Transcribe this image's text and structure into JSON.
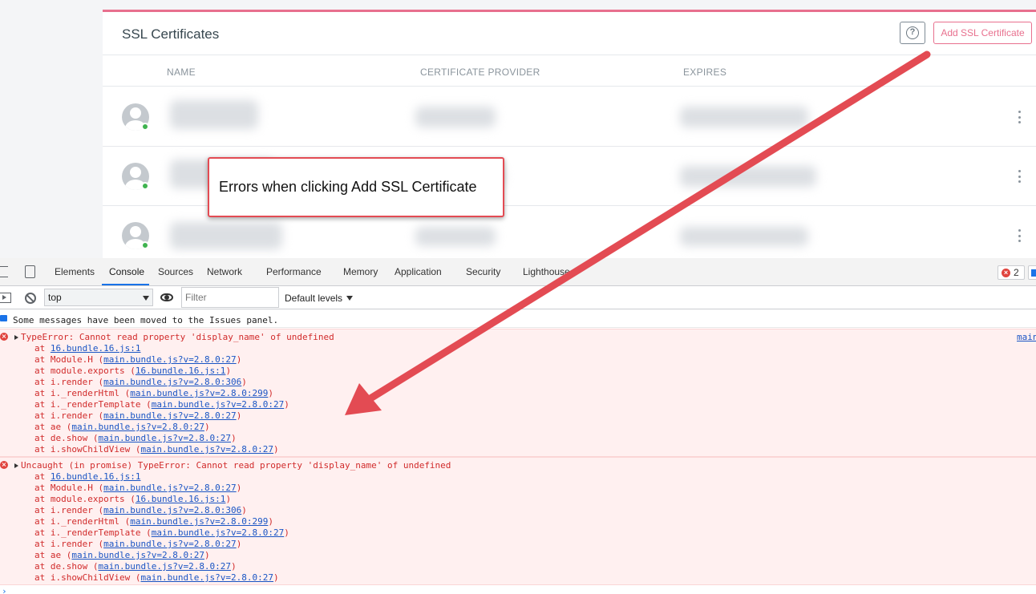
{
  "app": {
    "title": "SSL Certificates",
    "help_icon": "question-circle-icon",
    "help_glyph": "?",
    "add_button": "Add SSL Certificate",
    "columns": [
      "NAME",
      "CERTIFICATE PROVIDER",
      "EXPIRES"
    ],
    "rows": [
      {
        "avatar": "user-avatar-icon",
        "status": "online"
      },
      {
        "avatar": "user-avatar-icon",
        "status": "online"
      },
      {
        "avatar": "user-avatar-icon",
        "status": "online"
      }
    ],
    "accent_color": "#e8708e",
    "status_color": "#3fb34f"
  },
  "annotation": {
    "callout_text": "Errors when clicking Add SSL Certificate",
    "color": "#e34b53"
  },
  "devtools": {
    "tabs": [
      "Elements",
      "Console",
      "Sources",
      "Network",
      "Performance",
      "Memory",
      "Application",
      "Security",
      "Lighthouse"
    ],
    "active_tab": "Console",
    "error_count": "2",
    "context": "top",
    "filter_placeholder": "Filter",
    "levels": "Default levels",
    "info_message": "Some messages have been moved to the Issues panel.",
    "errors": [
      {
        "message": "TypeError: Cannot read property 'display_name' of undefined",
        "source": "main",
        "frames": [
          {
            "fn": "",
            "loc": "16.bundle.16.js:1"
          },
          {
            "fn": "Module.H",
            "loc": "main.bundle.js?v=2.8.0:27"
          },
          {
            "fn": "module.exports",
            "loc": "16.bundle.16.js:1"
          },
          {
            "fn": "i.render",
            "loc": "main.bundle.js?v=2.8.0:306"
          },
          {
            "fn": "i._renderHtml",
            "loc": "main.bundle.js?v=2.8.0:299"
          },
          {
            "fn": "i._renderTemplate",
            "loc": "main.bundle.js?v=2.8.0:27"
          },
          {
            "fn": "i.render",
            "loc": "main.bundle.js?v=2.8.0:27"
          },
          {
            "fn": "ae",
            "loc": "main.bundle.js?v=2.8.0:27"
          },
          {
            "fn": "de.show",
            "loc": "main.bundle.js?v=2.8.0:27"
          },
          {
            "fn": "i.showChildView",
            "loc": "main.bundle.js?v=2.8.0:27"
          }
        ]
      },
      {
        "message": "Uncaught (in promise) TypeError: Cannot read property 'display_name' of undefined",
        "source": "",
        "frames": [
          {
            "fn": "",
            "loc": "16.bundle.16.js:1"
          },
          {
            "fn": "Module.H",
            "loc": "main.bundle.js?v=2.8.0:27"
          },
          {
            "fn": "module.exports",
            "loc": "16.bundle.16.js:1"
          },
          {
            "fn": "i.render",
            "loc": "main.bundle.js?v=2.8.0:306"
          },
          {
            "fn": "i._renderHtml",
            "loc": "main.bundle.js?v=2.8.0:299"
          },
          {
            "fn": "i._renderTemplate",
            "loc": "main.bundle.js?v=2.8.0:27"
          },
          {
            "fn": "i.render",
            "loc": "main.bundle.js?v=2.8.0:27"
          },
          {
            "fn": "ae",
            "loc": "main.bundle.js?v=2.8.0:27"
          },
          {
            "fn": "de.show",
            "loc": "main.bundle.js?v=2.8.0:27"
          },
          {
            "fn": "i.showChildView",
            "loc": "main.bundle.js?v=2.8.0:27"
          }
        ]
      }
    ],
    "prompt_glyph": "›"
  }
}
